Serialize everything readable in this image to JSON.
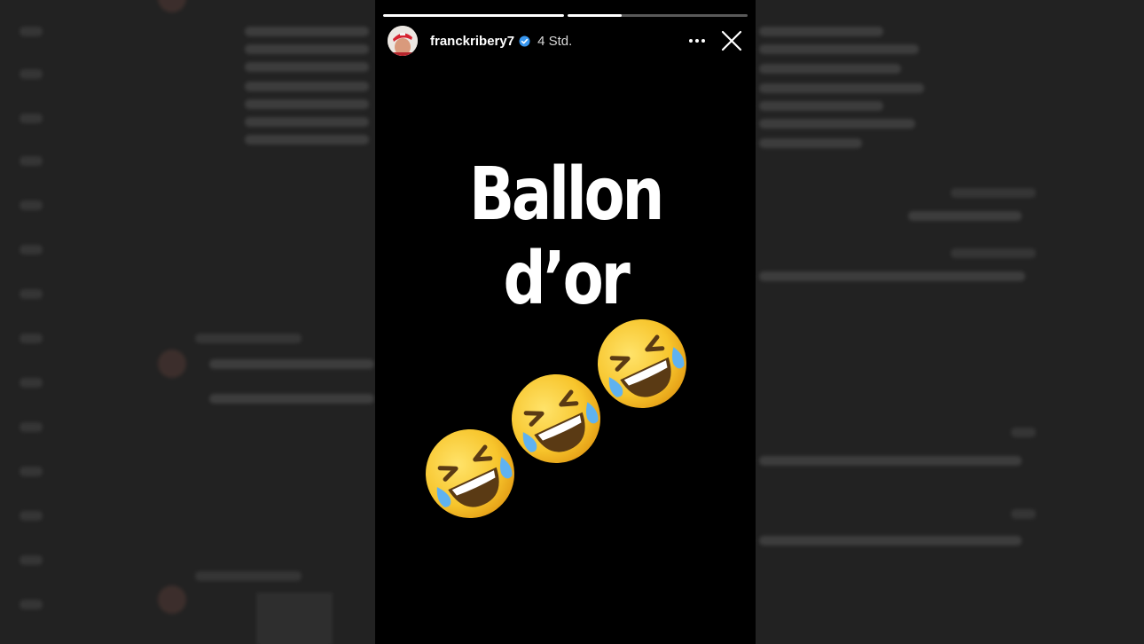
{
  "story": {
    "username": "franckribery7",
    "time_ago": "4 Std.",
    "text": "Ballon d’or",
    "progress": [
      1.0,
      0.3
    ],
    "icons": {
      "verified": "verified-badge-icon",
      "more": "more-options-icon",
      "close": "close-icon",
      "emoji": "rolling-on-the-floor-laughing-emoji"
    },
    "colors": {
      "background": "#000000",
      "text": "#ffffff",
      "verified": "#3897f0",
      "emoji_face": "#f7c52c"
    }
  }
}
